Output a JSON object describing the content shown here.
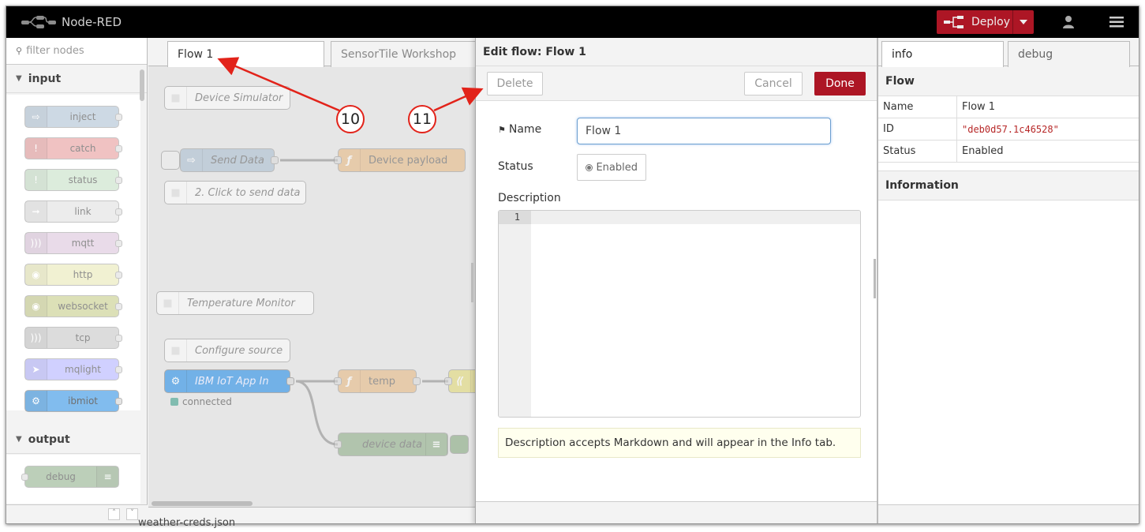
{
  "header": {
    "app_title": "Node-RED",
    "deploy_label": "Deploy"
  },
  "palette": {
    "filter_placeholder": "filter nodes",
    "categories": [
      "input",
      "output"
    ],
    "input_nodes": [
      {
        "label": "inject",
        "color": "#a6bbcf"
      },
      {
        "label": "catch",
        "color": "#e49191"
      },
      {
        "label": "status",
        "color": "#94c1d0"
      },
      {
        "label": "link",
        "color": "#dddddd"
      },
      {
        "label": "mqtt",
        "color": "#d8bfd8"
      },
      {
        "label": "http",
        "color": "#e7e7ae"
      },
      {
        "label": "websocket",
        "color": "#c0c77e"
      },
      {
        "label": "tcp",
        "color": "#c0c0c0"
      },
      {
        "label": "mqlight",
        "color": "#aaaaff"
      },
      {
        "label": "ibmiot",
        "color": "#4ca0e8"
      }
    ],
    "output_nodes": [
      {
        "label": "debug",
        "color": "#87a980"
      }
    ]
  },
  "workspace": {
    "tabs": [
      "Flow 1",
      "SensorTile Workshop"
    ],
    "nodes": {
      "device_simulator": "Device Simulator",
      "send_data": "Send Data",
      "device_payload": "Device payload",
      "click_to_send": "2. Click to send data",
      "temperature_monitor": "Temperature Monitor",
      "configure_source": "Configure source",
      "ibm_iot_app_in": "IBM IoT App In",
      "connected_status": "connected",
      "temp": "temp",
      "device_data": "device data"
    }
  },
  "edit_tray": {
    "title": "Edit flow: Flow 1",
    "delete_label": "Delete",
    "cancel_label": "Cancel",
    "done_label": "Done",
    "name_label": "Name",
    "name_value": "Flow 1",
    "status_label": "Status",
    "status_value": "Enabled",
    "description_label": "Description",
    "editor_line": "1",
    "tip": "Description accepts Markdown and will appear in the Info tab."
  },
  "sidebar": {
    "tabs": [
      "info",
      "debug"
    ],
    "flow_heading": "Flow",
    "rows": [
      {
        "key": "Name",
        "value": "Flow 1"
      },
      {
        "key": "ID",
        "value": "\"deb0d57.1c46528\""
      },
      {
        "key": "Status",
        "value": "Enabled"
      }
    ],
    "information_heading": "Information"
  },
  "annotations": {
    "callout_10": "10",
    "callout_11": "11",
    "accent": "#e2231a"
  },
  "background_text": "weather-creds.json",
  "colors": {
    "brand_red": "#ad1625",
    "header_bg": "#000000",
    "ibm_blue": "#4ca0e8"
  }
}
